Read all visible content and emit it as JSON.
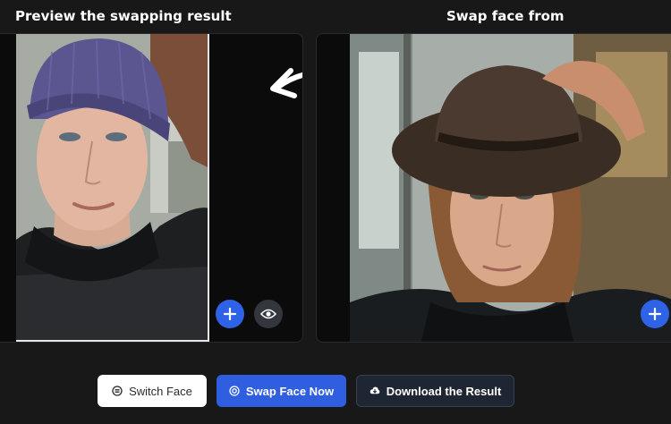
{
  "preview": {
    "heading": "Preview the swapping result",
    "photo_alt": "Young man wearing a purple knit beanie and dark jacket, face-swapped result"
  },
  "source": {
    "heading": "Swap face from",
    "photo_alt": "Young man with long light-brown hair wearing a dark brown hat and black shirt"
  },
  "icons": {
    "add": "plus-icon",
    "view": "eye-icon",
    "arrow": "curved-arrow-left-icon",
    "switch": "switch-icon",
    "swap": "target-icon",
    "download": "cloud-download-icon"
  },
  "actions": {
    "switch_label": "Switch Face",
    "swap_label": "Swap Face Now",
    "download_label": "Download the Result"
  },
  "colors": {
    "background": "#181818",
    "accent_blue": "#2f5fe0",
    "dark_button": "#1e2533",
    "text": "#ffffff"
  }
}
